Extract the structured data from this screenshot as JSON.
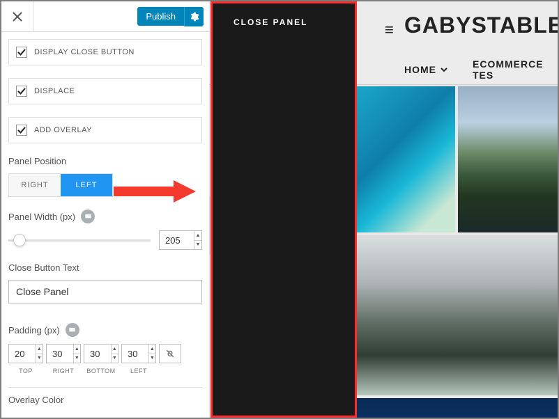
{
  "header": {
    "publish_label": "Publish"
  },
  "options": {
    "display_close_button": {
      "label": "DISPLAY CLOSE BUTTON",
      "checked": true
    },
    "displace": {
      "label": "DISPLACE",
      "checked": true
    },
    "add_overlay": {
      "label": "ADD OVERLAY",
      "checked": true
    }
  },
  "panel_position": {
    "label": "Panel Position",
    "options": {
      "right": "RIGHT",
      "left": "LEFT"
    },
    "selected": "left"
  },
  "panel_width": {
    "label": "Panel Width (px)",
    "value": "205"
  },
  "close_button_text": {
    "label": "Close Button Text",
    "value": "Close Panel"
  },
  "padding": {
    "label": "Padding (px)",
    "top": {
      "label": "TOP",
      "value": "20"
    },
    "right": {
      "label": "RIGHT",
      "value": "30"
    },
    "bottom": {
      "label": "BOTTOM",
      "value": "30"
    },
    "left": {
      "label": "LEFT",
      "value": "30"
    }
  },
  "overlay_color": {
    "label": "Overlay Color"
  },
  "preview": {
    "panel_close_text": "CLOSE PANEL",
    "site_title": "GABYSTABLE",
    "nav": {
      "home": "HOME",
      "ecommerce": "ECOMMERCE TES"
    }
  }
}
